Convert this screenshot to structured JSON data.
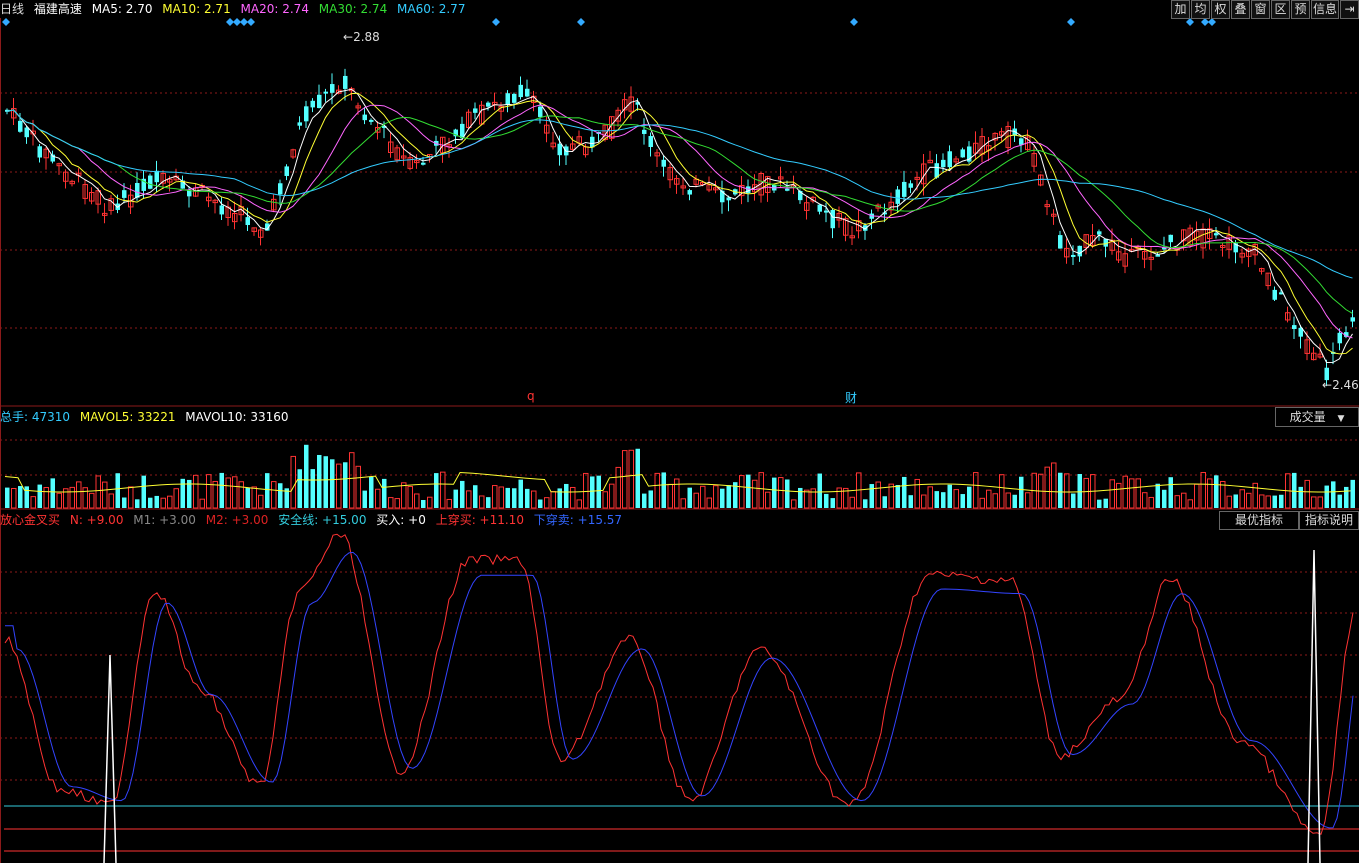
{
  "header": {
    "period": "日线",
    "stock_name": "福建高速",
    "ma": [
      {
        "label": "MA5: 2.70",
        "color": "#ffffff"
      },
      {
        "label": "MA10: 2.71",
        "color": "#ffff33"
      },
      {
        "label": "MA20: 2.74",
        "color": "#ff66ff"
      },
      {
        "label": "MA30: 2.74",
        "color": "#33dd33"
      },
      {
        "label": "MA60: 2.77",
        "color": "#33ccff"
      }
    ]
  },
  "toolbar": [
    "加",
    "均",
    "权",
    "叠",
    "窗",
    "区",
    "预",
    "信息",
    "⇥"
  ],
  "price_annotations": {
    "high": "2.88",
    "low": "2.46",
    "mark_q": "q",
    "mark_cai": "财"
  },
  "volume": {
    "total_label": "总手: 47310",
    "mavol5_label": "MAVOL5: 33221",
    "mavol10_label": "MAVOL10: 33160",
    "dropdown": "成交量"
  },
  "indicator": {
    "name": "放心金叉买",
    "params": [
      {
        "label": "N: +9.00",
        "color": "#ff3333"
      },
      {
        "label": "M1: +3.00",
        "color": "#888888"
      },
      {
        "label": "M2: +3.00",
        "color": "#dd2222"
      },
      {
        "label": "安全线: +15.00",
        "color": "#33ccdd"
      },
      {
        "label": "买入: +0",
        "color": "#ffffff"
      },
      {
        "label": "上穿买: +11.10",
        "color": "#ff3333"
      },
      {
        "label": "下穿卖: +15.57",
        "color": "#3366ff"
      }
    ],
    "btn_best": "最优指标",
    "btn_help": "指标说明"
  },
  "colors": {
    "up": "#ff3333",
    "down": "#54ffff",
    "grid": "#8b1a1a",
    "ma5": "#ffffff",
    "ma10": "#ffff33",
    "ma20": "#ff66ff",
    "ma30": "#33dd33",
    "ma60": "#33ccff"
  }
}
